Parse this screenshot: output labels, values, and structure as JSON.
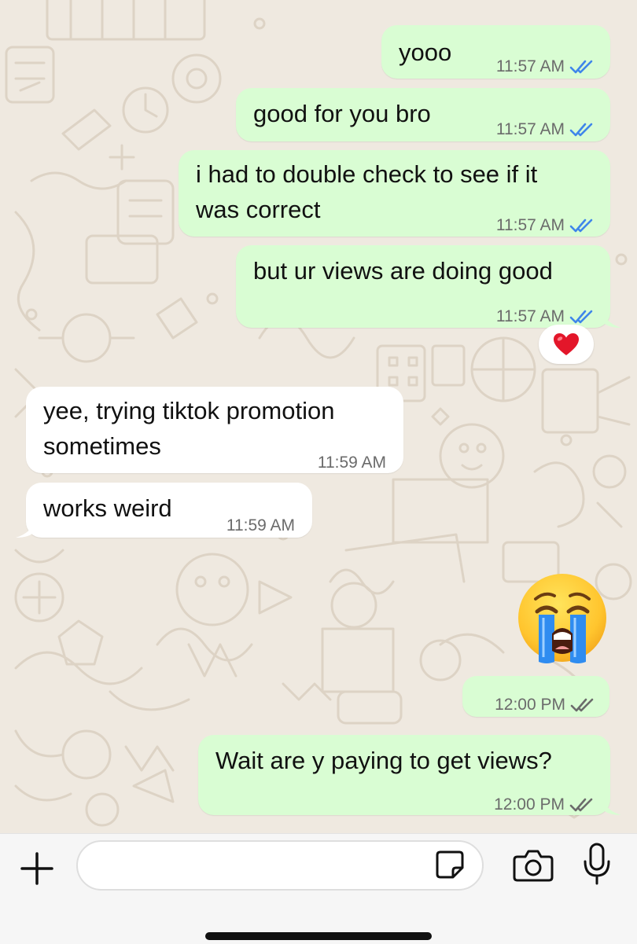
{
  "messages": [
    {
      "text": "yooo",
      "time": "11:57 AM",
      "direction": "outgoing",
      "status": "read"
    },
    {
      "text": "good for you bro",
      "time": "11:57 AM",
      "direction": "outgoing",
      "status": "read"
    },
    {
      "lines": [
        "i had to double check to see if it",
        "was correct"
      ],
      "time": "11:57 AM",
      "direction": "outgoing",
      "status": "read"
    },
    {
      "text": "but ur views are doing good",
      "time": "11:57 AM",
      "direction": "outgoing",
      "status": "read",
      "reaction": "heart"
    },
    {
      "lines": [
        "yee, trying tiktok promotion",
        "sometimes"
      ],
      "time": "11:59 AM",
      "direction": "incoming"
    },
    {
      "text": "works weird",
      "time": "11:59 AM",
      "direction": "incoming"
    },
    {
      "emoji": "loudly-crying-face",
      "time": "12:00 PM",
      "direction": "outgoing",
      "status": "delivered"
    },
    {
      "text": "Wait are y paying to get views?",
      "time": "12:00 PM",
      "direction": "outgoing",
      "status": "delivered"
    }
  ],
  "composer": {
    "input_value": "",
    "icons": [
      "plus-icon",
      "sticker-icon",
      "camera-icon",
      "microphone-icon"
    ]
  },
  "colors": {
    "outgoing_bubble": "#d9fdd3",
    "incoming_bubble": "#ffffff",
    "read_ticks": "#3f86ea",
    "delivered_ticks": "#6b6b6b",
    "wallpaper": "#efe9e0"
  }
}
